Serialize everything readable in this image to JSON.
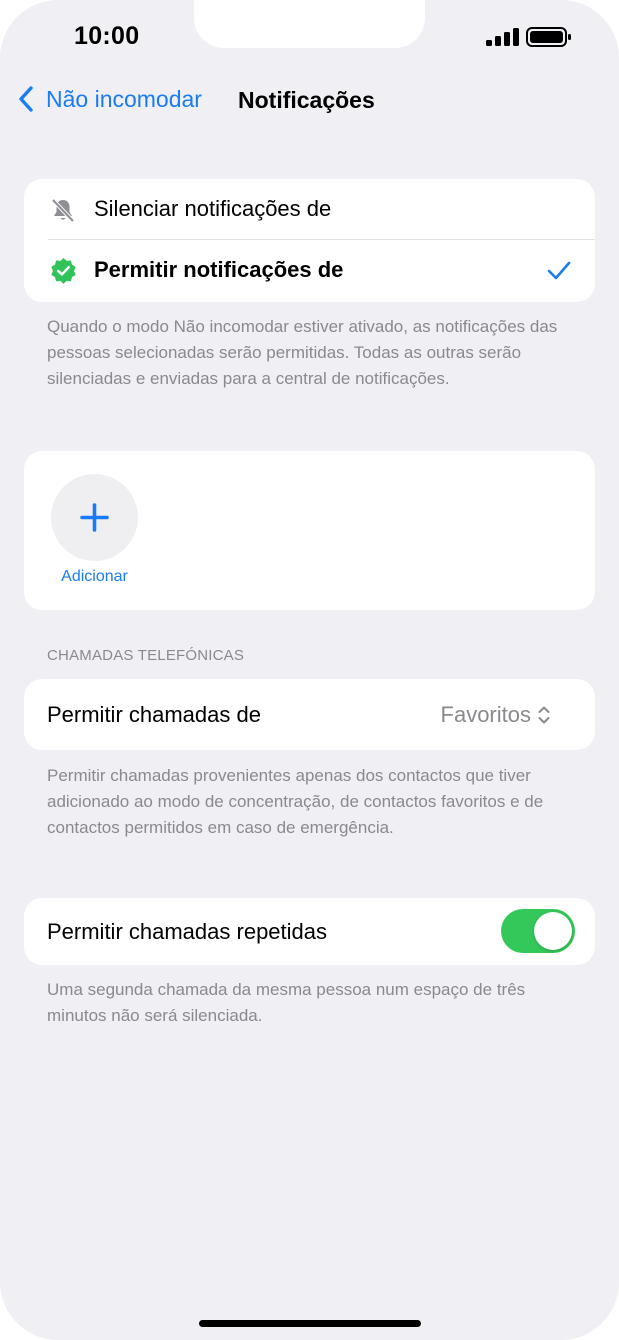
{
  "status_bar": {
    "time": "10:00"
  },
  "nav": {
    "back_label": "Não incomodar",
    "title": "Notificações"
  },
  "notification_mode": {
    "options": [
      {
        "label": "Silenciar notificações de",
        "icon": "bell-slash-icon",
        "selected": false
      },
      {
        "label": "Permitir notificações de",
        "icon": "verified-badge-icon",
        "selected": true
      }
    ],
    "footnote": "Quando o modo Não incomodar estiver ativado, as notificações das pessoas selecionadas serão permitidas. Todas as outras serão silenciadas e enviadas para a central de notificações."
  },
  "people": {
    "add_label": "Adicionar"
  },
  "calls": {
    "section_header": "CHAMADAS TELEFÓNICAS",
    "allow_calls_label": "Permitir chamadas de",
    "allow_calls_value": "Favoritos",
    "allow_calls_footnote": "Permitir chamadas provenientes apenas dos contactos que tiver adicionado ao modo de concentração, de contactos favoritos e de contactos permitidos em caso de emergência.",
    "repeated_calls_label": "Permitir chamadas repetidas",
    "repeated_calls_on": true,
    "repeated_calls_footnote": "Uma segunda chamada da mesma pessoa num espaço de três minutos não será silenciada."
  },
  "colors": {
    "accent": "#1a7cf5",
    "toggle_on": "#34c759",
    "badge_green": "#30c35a",
    "background": "#efeff4"
  }
}
